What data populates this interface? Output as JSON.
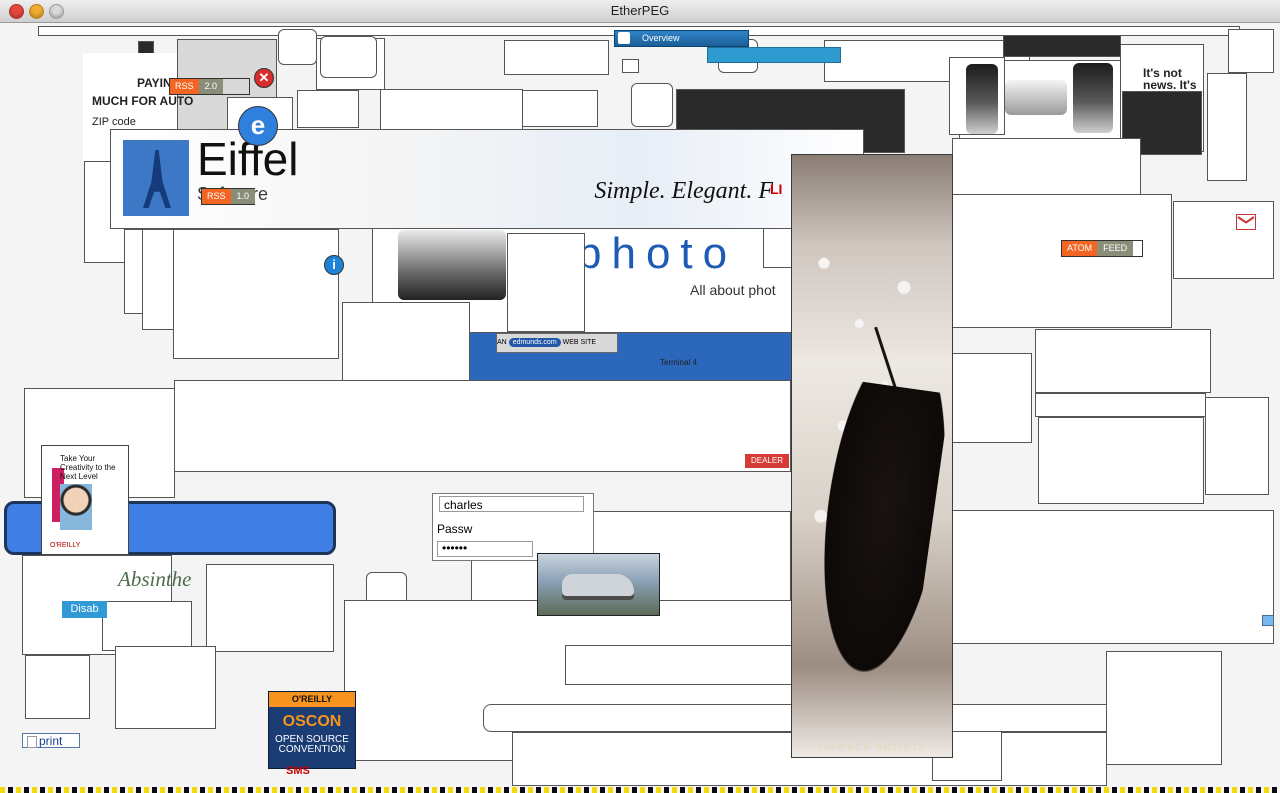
{
  "window": {
    "title": "EtherPEG"
  },
  "labels": {
    "rss": "RSS",
    "rss_v2": "2.0",
    "rss_v1": "1.0",
    "atom": "ATOM",
    "feed": "FEED",
    "overview": "Overview",
    "login_user": "charles",
    "password_label": "Passw",
    "password_mask": "••••••",
    "print": "print",
    "disab": "Disab",
    "eiffel": "Eiffel",
    "software": "Software",
    "tagline": "Simple. Elegant. F",
    "photo_banner": "photo",
    "photo_sub": "All about phot",
    "edmunds_prefix": "AN",
    "edmunds_brand": "edmunds.com",
    "edmunds_suffix": "WEB SITE",
    "terminal": "Terminal 4",
    "gawker_artists": "GAWKER ARTISTS",
    "oscon_brand": "O'REILLY",
    "oscon_main": "OSCON",
    "oscon_line1": "OPEN SOURCE",
    "oscon_line2": "CONVENTION",
    "book_title": "Take Your Creativity to the Next Level",
    "book_publisher": "O'REILLY",
    "absinthe": "Absinthe",
    "itsnot": "It's not news. It's",
    "zip_code": "ZIP code",
    "paying": "PAYIN",
    "much_for_auto": "MUCH FOR AUTO",
    "li": "LI",
    "dash": "DEALER",
    "sms": "SMS"
  },
  "icons": {
    "close": "close-icon",
    "minimize": "minimize-icon",
    "zoom": "zoom-icon",
    "error": "error-icon",
    "info": "info-icon",
    "browser": "browser-icon",
    "gmail": "mail-icon",
    "print": "print-icon"
  },
  "colors": {
    "accent_blue": "#1e5bb5",
    "rss_orange": "#f26522",
    "feed_gray": "#898e79",
    "oscon_orange": "#f7941d",
    "title_bar": "#d9d9d9"
  }
}
